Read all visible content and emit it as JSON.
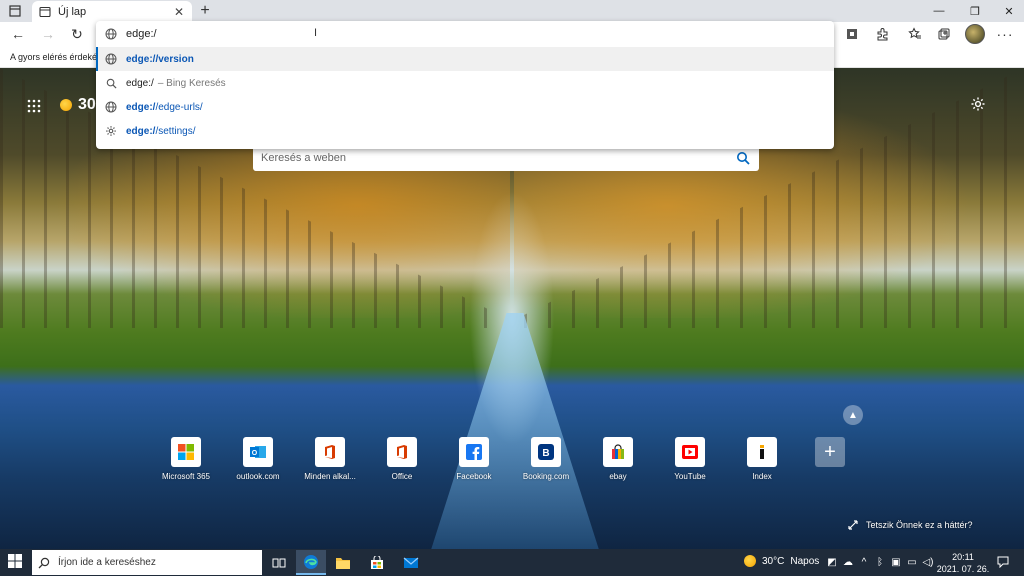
{
  "tab": {
    "title": "Új lap"
  },
  "window": {
    "minimize": "—",
    "restore": "❐",
    "close": "✕"
  },
  "favorites_bar": {
    "text": "A gyors elérés érdekében"
  },
  "omnibox": {
    "input_value": "edge:/",
    "suggestions": [
      {
        "bold": "edge://version",
        "rest": "",
        "sub": "",
        "icon": "globe-icon"
      },
      {
        "bold": "",
        "rest": "edge:/",
        "sub": "– Bing Keresés",
        "icon": "search-icon"
      },
      {
        "bold": "edge:/",
        "rest": "/edge-urls/",
        "sub": "",
        "icon": "globe-icon"
      },
      {
        "bold": "edge:/",
        "rest": "/settings/",
        "sub": "",
        "icon": "gear-icon"
      }
    ]
  },
  "ntp": {
    "weather_temp": "30",
    "search_placeholder": "Keresés a weben",
    "quick_links": [
      {
        "label": "Microsoft 365",
        "icon": "microsoft-icon",
        "color": "#f25022"
      },
      {
        "label": "outlook.com",
        "icon": "outlook-icon",
        "color": "#0078d4"
      },
      {
        "label": "Minden alkal...",
        "icon": "office-icon",
        "color": "#d83b01"
      },
      {
        "label": "Office",
        "icon": "office-icon",
        "color": "#d83b01"
      },
      {
        "label": "Facebook",
        "icon": "facebook-icon",
        "color": "#1877f2"
      },
      {
        "label": "Booking.com",
        "icon": "booking-icon",
        "color": "#003580"
      },
      {
        "label": "ebay",
        "icon": "ebay-bag-icon",
        "color": "#e53238"
      },
      {
        "label": "YouTube",
        "icon": "youtube-icon",
        "color": "#ff0000"
      },
      {
        "label": "Index",
        "icon": "index-icon",
        "color": "#111111"
      }
    ],
    "background_prompt": "Tetszik Önnek ez a háttér?"
  },
  "taskbar": {
    "search_placeholder": "Írjon ide a kereséshez",
    "weather": {
      "temp": "30°C",
      "condition": "Napos"
    },
    "clock": {
      "time": "20:11",
      "date": "2021. 07. 26."
    }
  }
}
